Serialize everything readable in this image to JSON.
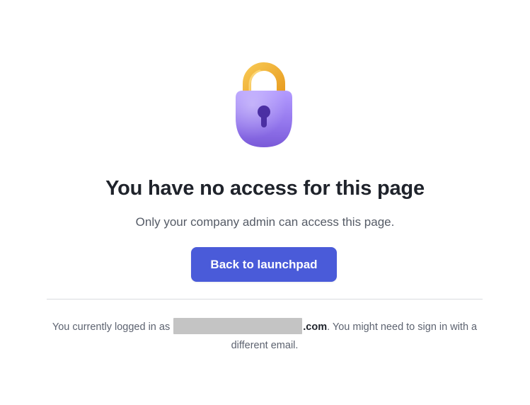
{
  "heading": "You have no access for this page",
  "subheading": "Only your company admin can access this page.",
  "back_button_label": "Back to launchpad",
  "footer": {
    "prefix": "You currently logged in as",
    "email_domain": ".com",
    "suffix": ". You might need to sign in with a different email."
  },
  "icons": {
    "lock": "padlock-icon"
  },
  "colors": {
    "accent": "#4a5bd9",
    "lock_body": "#9b7cf0",
    "lock_shackle": "#f2b23c"
  }
}
